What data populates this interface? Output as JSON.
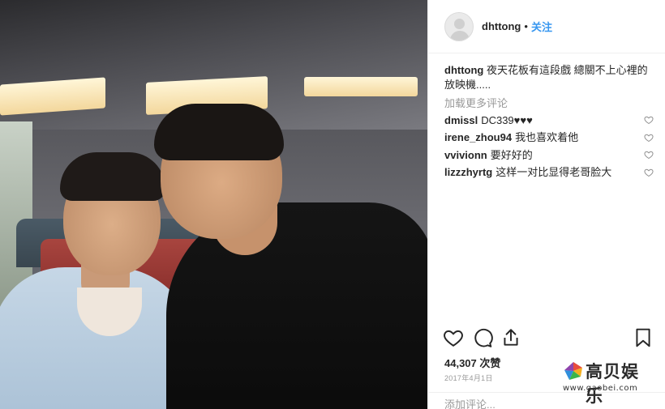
{
  "post_header": {
    "username": "dhttong",
    "separator": "•",
    "follow_label": "关注"
  },
  "caption": {
    "username": "dhttong",
    "text": "夜天花板有這段戲 總關不上心裡的放映機....."
  },
  "load_more_label": "加载更多评论",
  "comments": [
    {
      "username": "dmissl",
      "text": "DC339♥♥♥"
    },
    {
      "username": "irene_zhou94",
      "text": "我也喜欢着他"
    },
    {
      "username": "vvivionn",
      "text": "要好好的"
    },
    {
      "username": "lizzzhyrtg",
      "text": "这样一对比显得老哥脸大"
    }
  ],
  "likes": {
    "count": "44,307",
    "label": "次赞"
  },
  "date": "2017年4月1日",
  "add_comment": {
    "placeholder": "添加评论..."
  },
  "watermark": {
    "name": "高贝娱乐",
    "url": "www.gaobei.com"
  },
  "colors": {
    "accent": "#3897f0",
    "muted": "#999999",
    "text": "#262626"
  },
  "icons": [
    "heart-icon",
    "comment-icon",
    "share-icon",
    "bookmark-icon"
  ]
}
